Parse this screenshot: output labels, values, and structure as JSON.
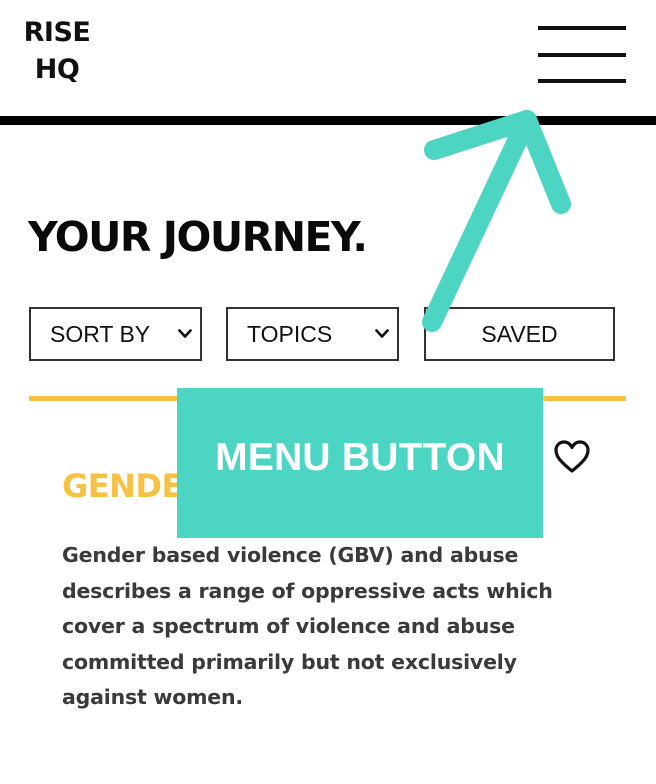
{
  "header": {
    "logo_line1": "RISE",
    "logo_line2": "HQ",
    "menu_icon": "hamburger-icon"
  },
  "main": {
    "title": "YOUR JOURNEY."
  },
  "filters": {
    "sort_label": "SORT BY",
    "topics_label": "TOPICS",
    "saved_label": "SAVED",
    "chevron_icon": "chevron-down-icon"
  },
  "card": {
    "title": "GENDE",
    "description": "Gender based violence (GBV) and abuse describes a range of oppressive acts which cover a spectrum of violence and abuse committed primarily but not exclusively against women.",
    "heart_icon": "heart-outline-icon"
  },
  "annotation": {
    "label": "MENU BUTTON",
    "arrow_icon": "arrow-icon"
  },
  "colors": {
    "accent_yellow": "#f7c243",
    "callout_teal": "#4dd5c4",
    "text_dark": "#111111",
    "text_body": "#3a3a3a"
  }
}
